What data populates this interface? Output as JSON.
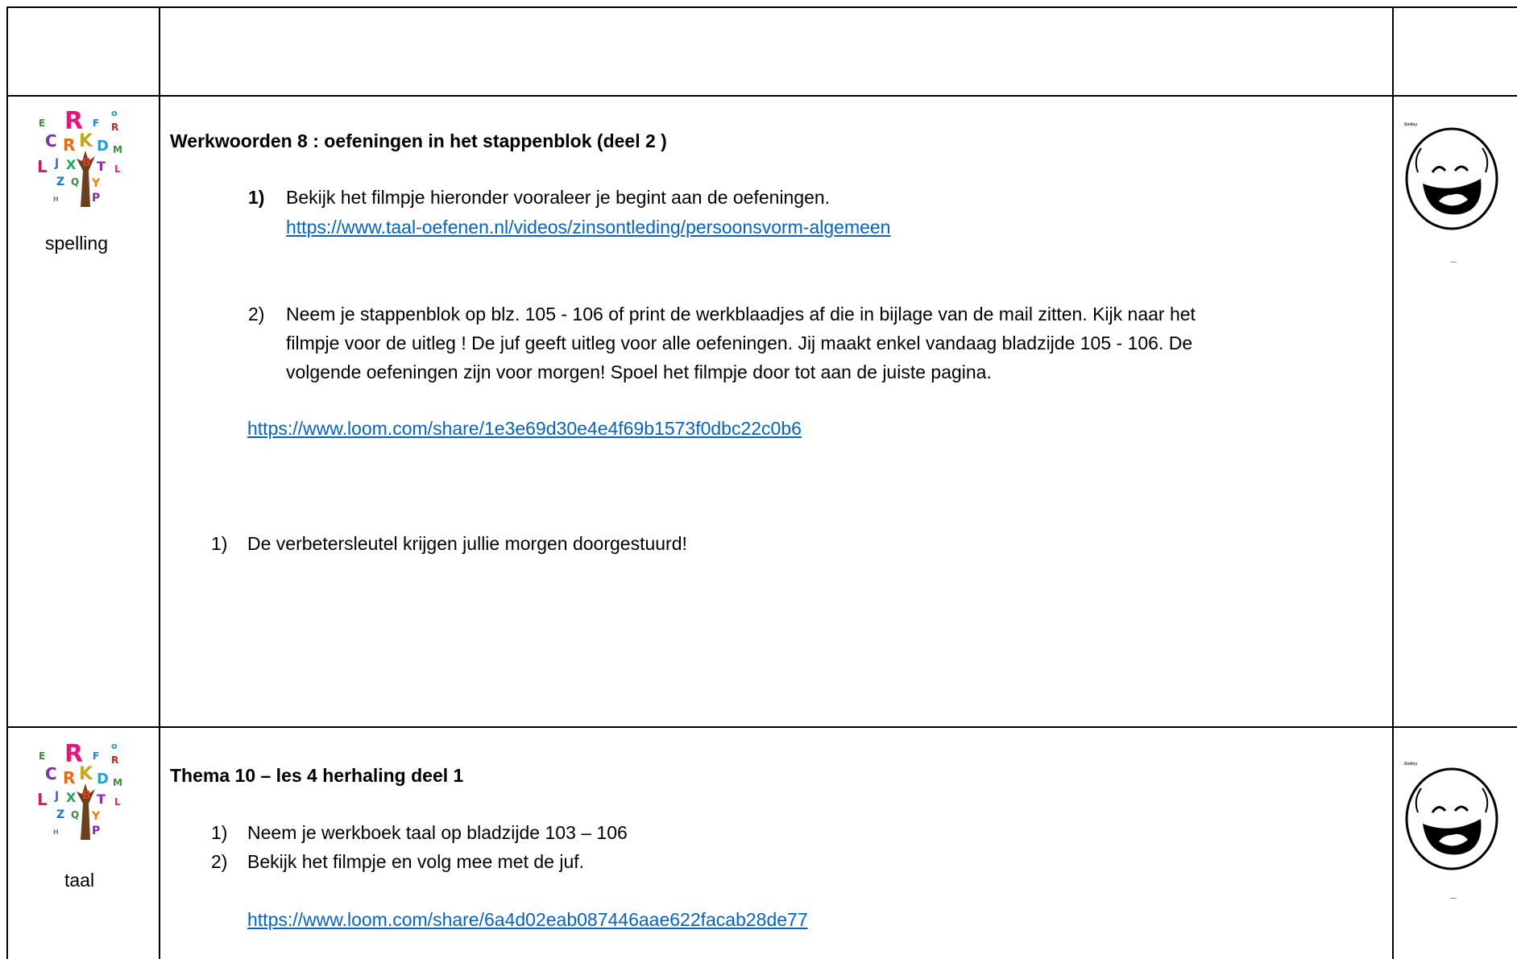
{
  "rows": [
    {
      "subject_label": "spelling",
      "title": "Werkwoorden 8 : oefeningen in het stappenblok (deel 2 )",
      "step1": {
        "number": "1)",
        "text": "Bekijk het filmpje hieronder vooraleer je begint aan de oefeningen.",
        "link": "https://www.taal-oefenen.nl/videos/zinsontleding/persoonsvorm-algemeen"
      },
      "step2": {
        "number": "2)",
        "lines": [
          "Neem je stappenblok op blz.   105 - 106 of print de werkblaadjes af die in bijlage van de mail zitten. Kijk naar het",
          "filmpje voor de uitleg ! De juf geeft uitleg voor alle oefeningen. Jij maakt enkel vandaag bladzijde 105 - 106. De",
          "volgende oefeningen zijn voor morgen! Spoel het filmpje door tot aan de juiste pagina."
        ],
        "link": "https://www.loom.com/share/1e3e69d30e4e4f69b1573f0dbc22c0b6"
      },
      "step3": {
        "number": "1)",
        "text": "De verbetersleutel krijgen jullie morgen doorgestuurd!"
      },
      "smiley_caption": "Smiley"
    },
    {
      "subject_label": "taal",
      "title": "Thema 10 – les 4 herhaling deel 1",
      "items": [
        {
          "number": "1)",
          "text": "Neem je werkboek taal op bladzijde 103 – 106"
        },
        {
          "number": "2)",
          "text": "Bekijk het filmpje en volg mee met de juf."
        }
      ],
      "link": "https://www.loom.com/share/6a4d02eab087446aae622facab28de77",
      "smiley_caption": "Smiley"
    }
  ],
  "icons": {
    "tree": "alphabet-tree-icon",
    "smiley": "laughing-smiley-icon"
  }
}
